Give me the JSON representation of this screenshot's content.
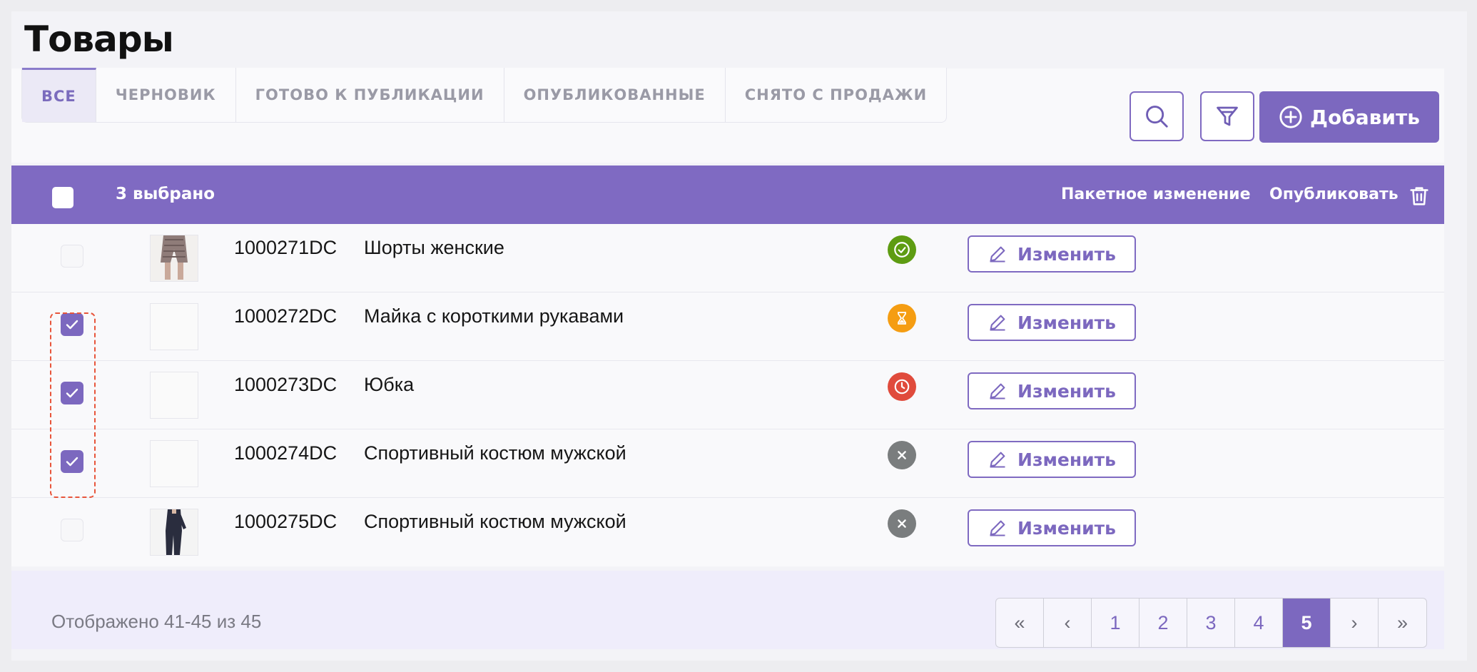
{
  "page": {
    "title": "Товары"
  },
  "tabs": [
    {
      "label": "ВСЕ",
      "active": true
    },
    {
      "label": "ЧЕРНОВИК",
      "active": false
    },
    {
      "label": "ГОТОВО К ПУБЛИКАЦИИ",
      "active": false
    },
    {
      "label": "ОПУБЛИКОВАННЫЕ",
      "active": false
    },
    {
      "label": "СНЯТО С ПРОДАЖИ",
      "active": false
    }
  ],
  "toolbar": {
    "add_label": "Добавить",
    "search_icon": "search-icon",
    "filter_icon": "filter-icon"
  },
  "selection": {
    "count_label": "3 выбрано",
    "batch_label": "Пакетное изменение",
    "publish_label": "Опубликовать"
  },
  "colors": {
    "accent": "#7c68bf",
    "status_published": "#5e9c12",
    "status_pending": "#f59d12",
    "status_scheduled": "#e04b3c",
    "status_removed": "#7a7d7e"
  },
  "products": [
    {
      "sku": "1000271DC",
      "name": "Шорты женские",
      "checked": false,
      "status": "published",
      "status_icon": "check-circle-icon",
      "thumb": "shorts",
      "edit_label": "Изменить"
    },
    {
      "sku": "1000272DC",
      "name": "Майка с короткими рукавами",
      "checked": true,
      "status": "pending",
      "status_icon": "hourglass-icon",
      "thumb": "empty",
      "edit_label": "Изменить"
    },
    {
      "sku": "1000273DC",
      "name": "Юбка",
      "checked": true,
      "status": "scheduled",
      "status_icon": "clock-icon",
      "thumb": "empty",
      "edit_label": "Изменить"
    },
    {
      "sku": "1000274DC",
      "name": "Спортивный костюм мужской",
      "checked": true,
      "status": "removed",
      "status_icon": "x-icon",
      "thumb": "empty",
      "edit_label": "Изменить"
    },
    {
      "sku": "1000275DC",
      "name": "Спортивный костюм мужской",
      "checked": false,
      "status": "removed",
      "status_icon": "x-icon",
      "thumb": "suit",
      "edit_label": "Изменить"
    }
  ],
  "footer": {
    "showing": "Отображено 41-45 из 45"
  },
  "pagination": {
    "first": "«",
    "prev": "‹",
    "pages": [
      "1",
      "2",
      "3",
      "4",
      "5"
    ],
    "current": "5",
    "next": "›",
    "last": "»"
  }
}
